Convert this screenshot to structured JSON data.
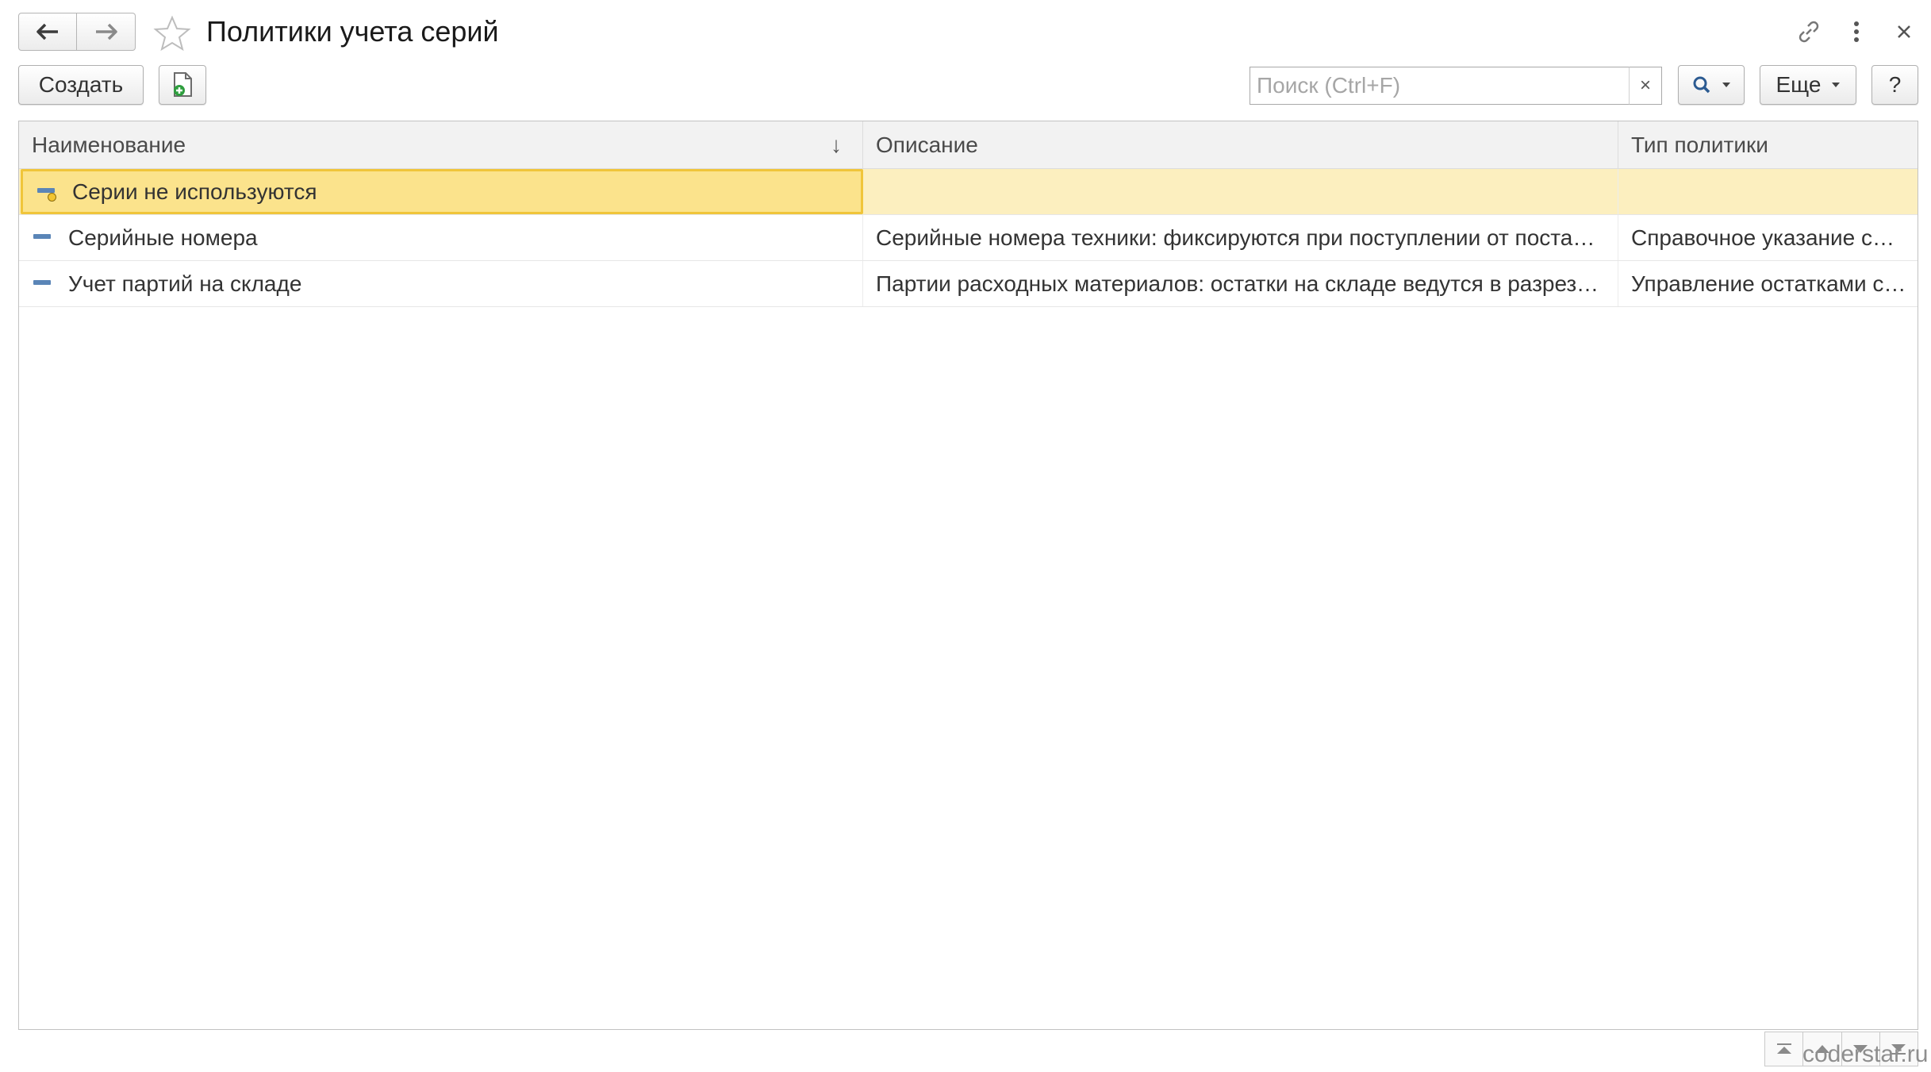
{
  "window": {
    "title": "Политики учета серий"
  },
  "toolbar": {
    "create_label": "Создать",
    "search_placeholder": "Поиск (Ctrl+F)",
    "search_value": "",
    "clear_symbol": "×",
    "more_label": "Еще",
    "help_label": "?"
  },
  "grid": {
    "columns": [
      {
        "label": "Наименование",
        "sort": "↓"
      },
      {
        "label": "Описание"
      },
      {
        "label": "Тип политики"
      }
    ],
    "rows": [
      {
        "name": "Серии не используются",
        "description": "",
        "policy_type": "",
        "selected": true
      },
      {
        "name": "Серийные номера",
        "description": "Серийные номера техники: фиксируются при поступлении от постав…",
        "policy_type": "Справочное указание се…",
        "selected": false
      },
      {
        "name": "Учет партий на складе",
        "description": "Партии расходных материалов: остатки на складе ведутся в разрезе …",
        "policy_type": "Управление остатками с…",
        "selected": false
      }
    ]
  },
  "watermark": "coderstar.ru",
  "colors": {
    "selected_row": "#fcefbf",
    "current_cell": "#fbe38c",
    "current_cell_border": "#f0c53a",
    "header_bg": "#f2f2f2",
    "item_icon": "#5a85b7"
  }
}
